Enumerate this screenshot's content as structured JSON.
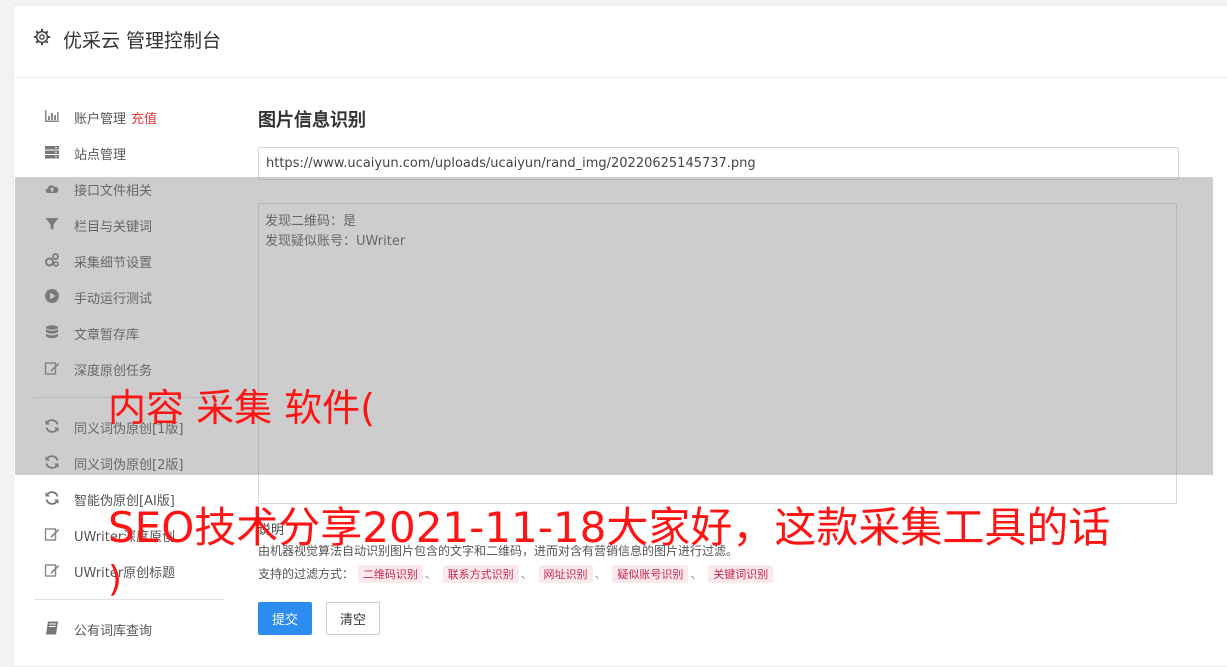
{
  "header": {
    "title": "优采云 管理控制台",
    "icon": "gear-icon"
  },
  "sidebar": {
    "group1": [
      {
        "label": "账户管理",
        "badge": "充值",
        "icon": "bar-chart-icon"
      },
      {
        "label": "站点管理",
        "icon": "server-icon"
      },
      {
        "label": "接口文件相关",
        "icon": "cloud-upload-icon"
      },
      {
        "label": "栏目与关键词",
        "icon": "filter-icon"
      },
      {
        "label": "采集细节设置",
        "icon": "gears-icon"
      },
      {
        "label": "手动运行测试",
        "icon": "play-circle-icon"
      },
      {
        "label": "文章暂存库",
        "icon": "database-icon"
      },
      {
        "label": "深度原创任务",
        "icon": "edit-icon"
      }
    ],
    "group2": [
      {
        "label": "同义词伪原创[1版]",
        "icon": "refresh-icon"
      },
      {
        "label": "同义词伪原创[2版]",
        "icon": "refresh-icon"
      },
      {
        "label": "智能伪原创[AI版]",
        "icon": "refresh-icon"
      },
      {
        "label": "UWriter深度原创",
        "icon": "edit-icon"
      },
      {
        "label": "UWriter原创标题",
        "icon": "edit-icon"
      }
    ],
    "group3": [
      {
        "label": "公有词库查询",
        "icon": "book-icon"
      }
    ]
  },
  "main": {
    "title": "图片信息识别",
    "url_value": "https://www.ucaiyun.com/uploads/ucaiyun/rand_img/20220625145737.png",
    "result_text": "发现二维码：是\n发现疑似账号：UWriter",
    "note_title": "说明",
    "note_desc": "由机器视觉算法自动识别图片包含的文字和二维码，进而对含有营销信息的图片进行过滤。",
    "filter_prefix": "支持的过滤方式：",
    "filter_tags": [
      "二维码识别",
      "联系方式识别",
      "网址识别",
      "疑似账号识别",
      "关键词识别"
    ],
    "filter_sep": "、",
    "submit_label": "提交",
    "clear_label": "清空"
  },
  "watermark": {
    "line1": "内容 采集 软件(",
    "line2": "SEO技术分享2021-11-18大家好，这款采集工具的话",
    "line3": ")"
  }
}
